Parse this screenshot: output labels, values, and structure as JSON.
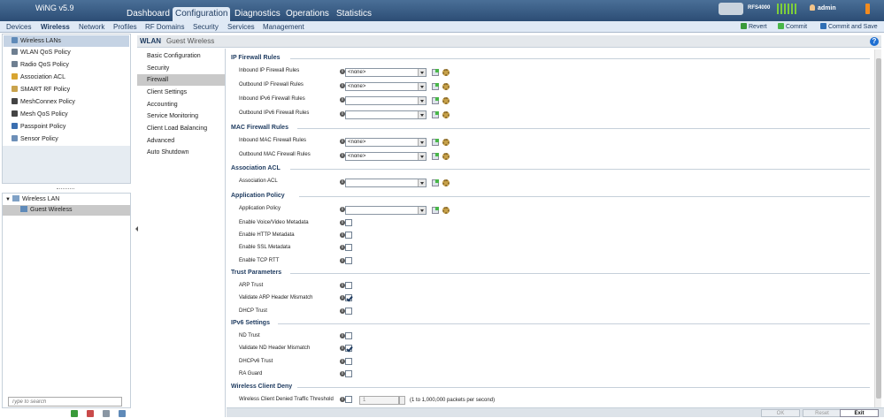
{
  "header": {
    "logo": "WiNG v5.9",
    "main_tabs": [
      "Dashboard",
      "Configuration",
      "Diagnostics",
      "Operations",
      "Statistics"
    ],
    "device": "RFS4000",
    "user": "admin"
  },
  "subnav": {
    "tabs": [
      "Devices",
      "Wireless",
      "Network",
      "Profiles",
      "RF Domains",
      "Security",
      "Services",
      "Management"
    ],
    "actions": {
      "revert": "Revert",
      "commit": "Commit",
      "commit_save": "Commit and Save"
    }
  },
  "sidebar": {
    "items": [
      "Wireless LANs",
      "WLAN QoS Policy",
      "Radio QoS Policy",
      "Association ACL",
      "SMART RF Policy",
      "MeshConnex Policy",
      "Mesh QoS Policy",
      "Passpoint Policy",
      "Sensor Policy"
    ],
    "tree": {
      "root": "Wireless LAN",
      "child": "Guest Wireless"
    },
    "search_placeholder": "Type to search"
  },
  "breadcrumb": {
    "section": "WLAN",
    "title": "Guest Wireless"
  },
  "wlan_nav": [
    "Basic Configuration",
    "Security",
    "Firewall",
    "Client Settings",
    "Accounting",
    "Service Monitoring",
    "Client Load Balancing",
    "Advanced",
    "Auto Shutdown"
  ],
  "firewall": {
    "ip_title": "IP Firewall Rules",
    "ip_rows": [
      {
        "label": "Inbound IP Firewall Rules",
        "value": "<none>"
      },
      {
        "label": "Outbound IP Firewall Rules",
        "value": "<none>"
      },
      {
        "label": "Inbound IPv6 Firewall Rules",
        "value": ""
      },
      {
        "label": "Outbound IPv6 Firewall Rules",
        "value": ""
      }
    ],
    "mac_title": "MAC Firewall Rules",
    "mac_rows": [
      {
        "label": "Inbound MAC Firewall Rules",
        "value": "<none>"
      },
      {
        "label": "Outbound MAC Firewall Rules",
        "value": "<none>"
      }
    ],
    "acl_title": "Association ACL",
    "acl_label": "Association ACL",
    "app_title": "Application Policy",
    "app_label": "Application Policy",
    "app_checks": [
      "Enable Voice/Video Metadata",
      "Enable HTTP Metadata",
      "Enable SSL Metadata",
      "Enable TCP RTT"
    ],
    "trust_title": "Trust Parameters",
    "trust_checks": [
      {
        "label": "ARP Trust",
        "checked": false
      },
      {
        "label": "Validate ARP Header Mismatch",
        "checked": true
      },
      {
        "label": "DHCP Trust",
        "checked": false
      }
    ],
    "ipv6_title": "IPv6 Settings",
    "ipv6_checks": [
      {
        "label": "ND Trust",
        "checked": false
      },
      {
        "label": "Validate ND Header Mismatch",
        "checked": true
      },
      {
        "label": "DHCPv6 Trust",
        "checked": false
      },
      {
        "label": "RA Guard",
        "checked": false
      }
    ],
    "deny_title": "Wireless Client Deny",
    "deny_label": "Wireless Client Denied Traffic Threshold",
    "deny_value": "1",
    "deny_range": "(1 to 1,000,000 packets per second)"
  },
  "footer": {
    "ok": "OK",
    "reset": "Reset",
    "exit": "Exit"
  }
}
